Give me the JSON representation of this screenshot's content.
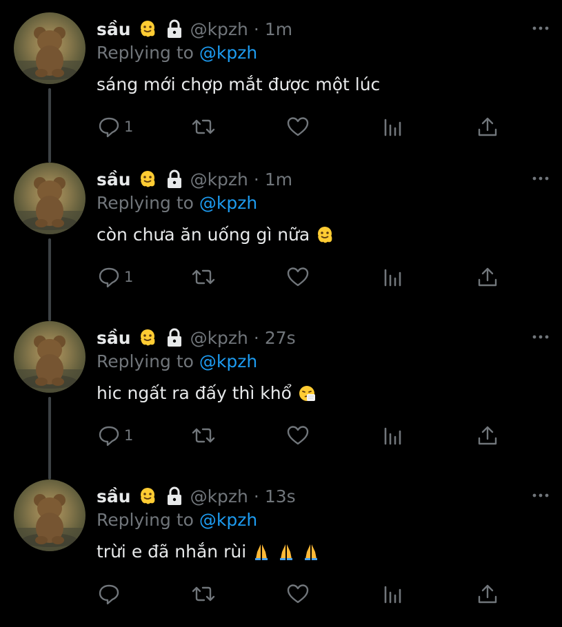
{
  "colors": {
    "background": "#000000",
    "primary_text": "#e7e9ea",
    "secondary_text": "#71767b",
    "link": "#1d9bf0",
    "thread_line": "#3d4245"
  },
  "tweets": [
    {
      "display_name": "sầu",
      "name_emoji": "melting-face",
      "protected_icon": "lock-icon",
      "handle": "@kpzh",
      "separator": "·",
      "time": "1m",
      "replying_prefix": "Replying to",
      "replying_to": "@kpzh",
      "text": "sáng mới chợp mắt được một lúc",
      "text_emoji": [],
      "reply_count": "1"
    },
    {
      "display_name": "sầu",
      "name_emoji": "melting-face",
      "protected_icon": "lock-icon",
      "handle": "@kpzh",
      "separator": "·",
      "time": "1m",
      "replying_prefix": "Replying to",
      "replying_to": "@kpzh",
      "text": "còn chưa ăn uống gì nữa",
      "text_emoji": [
        "melting-face"
      ],
      "reply_count": "1"
    },
    {
      "display_name": "sầu",
      "name_emoji": "melting-face",
      "protected_icon": "lock-icon",
      "handle": "@kpzh",
      "separator": "·",
      "time": "27s",
      "replying_prefix": "Replying to",
      "replying_to": "@kpzh",
      "text": "hic ngất ra đấy thì khổ",
      "text_emoji": [
        "sneezing-face"
      ],
      "reply_count": "1"
    },
    {
      "display_name": "sầu",
      "name_emoji": "melting-face",
      "protected_icon": "lock-icon",
      "handle": "@kpzh",
      "separator": "·",
      "time": "13s",
      "replying_prefix": "Replying to",
      "replying_to": "@kpzh",
      "text": "trừi e đã nhắn rùi",
      "text_emoji": [
        "folded-hands",
        "folded-hands",
        "folded-hands"
      ],
      "reply_count": ""
    }
  ]
}
